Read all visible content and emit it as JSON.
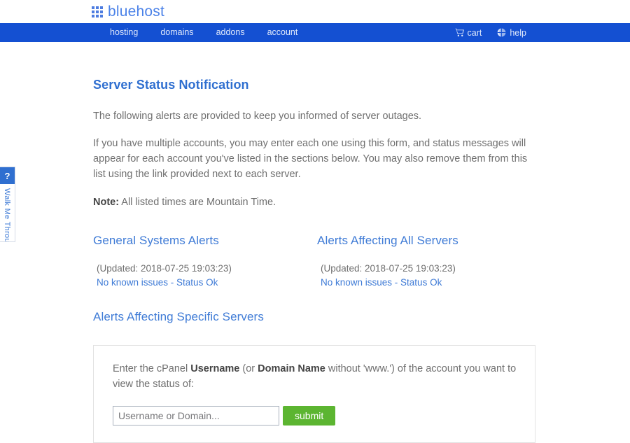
{
  "brand": {
    "logo_word": "bluehost",
    "logo_icon": "grid-squares-icon",
    "logo_color": "#4b82e8"
  },
  "nav": {
    "background_color": "#1450d2",
    "left_items": [
      {
        "label": "hosting"
      },
      {
        "label": "domains"
      },
      {
        "label": "addons"
      },
      {
        "label": "account"
      }
    ],
    "right_items": [
      {
        "label": "cart",
        "icon": "shopping-cart-icon"
      },
      {
        "label": "help",
        "icon": "globe-help-icon"
      }
    ]
  },
  "walkme": {
    "badge": "?",
    "label": "Walk Me Throu",
    "accent_color": "#2f6fd0"
  },
  "page": {
    "title": "Server Status Notification",
    "title_color": "#2f6fd0",
    "intro": "The following alerts are provided to keep you informed of server outages.",
    "description": "If you have multiple accounts, you may enter each one using this form, and status messages will appear for each account you've listed in the sections below. You may also remove them from this list using the link provided next to each server.",
    "note_label": "Note:",
    "note_text": " All listed times are Mountain Time."
  },
  "alert_sections": [
    {
      "heading": "General Systems Alerts",
      "updated": "(Updated: 2018-07-25 19:03:23)",
      "status": "No known issues - Status Ok"
    },
    {
      "heading": "Alerts Affecting All Servers",
      "updated": "(Updated: 2018-07-25 19:03:23)",
      "status": "No known issues - Status Ok"
    }
  ],
  "specific": {
    "heading": "Alerts Affecting Specific Servers",
    "prompt_part1": "Enter the cPanel ",
    "prompt_bold1": "Username",
    "prompt_part2": " (or ",
    "prompt_bold2": "Domain Name",
    "prompt_part3": " without 'www.') of the account you want to view the status of:",
    "input_value": "",
    "input_placeholder": "Username or Domain...",
    "submit_label": "submit",
    "submit_color": "#5cb531"
  }
}
